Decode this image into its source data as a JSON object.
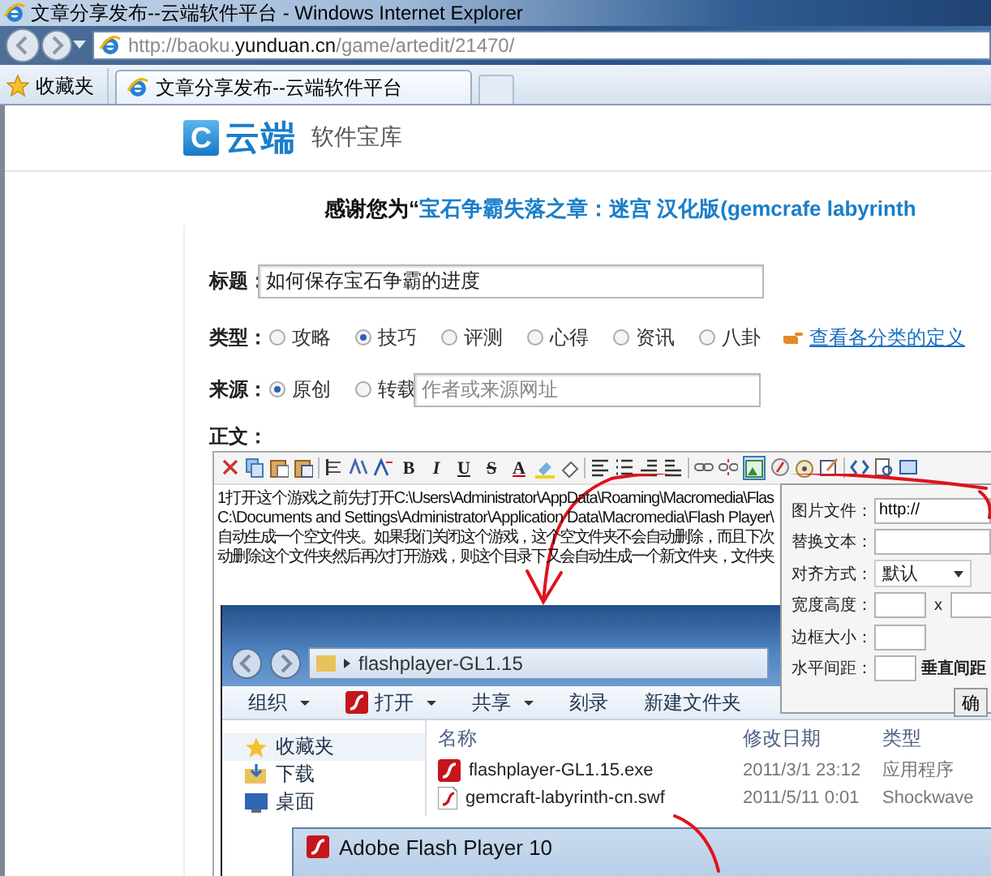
{
  "window": {
    "title": "文章分享发布--云端软件平台 - Windows Internet Explorer"
  },
  "address_bar": {
    "url": "http://baoku.**yunduan.cn**/game/artedit/21470/"
  },
  "favorites": {
    "label": "收藏夹"
  },
  "tabs": [
    {
      "label": "文章分享发布--云端软件平台",
      "selected": true
    }
  ],
  "site": {
    "logo_mark": "C",
    "logo_name": "云端",
    "logo_subtitle": "软件宝库"
  },
  "heading": {
    "prefix": "感谢您为“",
    "game_name": "宝石争霸失落之章：迷宫 汉化版(gemcrafe labyrinth"
  },
  "form": {
    "title_label": "标题：",
    "title_value": "如何保存宝石争霸的进度",
    "type_label": "类型：",
    "types": [
      {
        "label": "攻略",
        "selected": false
      },
      {
        "label": "技巧",
        "selected": true
      },
      {
        "label": "评测",
        "selected": false
      },
      {
        "label": "心得",
        "selected": false
      },
      {
        "label": "资讯",
        "selected": false
      },
      {
        "label": "八卦",
        "selected": false
      }
    ],
    "type_help_link": "查看各分类的定义",
    "source_label": "来源：",
    "sources": [
      {
        "label": "原创",
        "selected": true
      },
      {
        "label": "转载",
        "selected": false
      }
    ],
    "source_placeholder": "作者或来源网址",
    "body_label": "正文："
  },
  "editor": {
    "format_buttons": [
      "B",
      "I",
      "U",
      "S",
      "A"
    ],
    "image_tool_active": true,
    "lines": [
      "1打开这个游戏之前先打开C:\\Users\\Administrator\\AppData\\Roaming\\Macromedia\\Flas",
      "C:\\Documents and Settings\\Administrator\\Application Data\\Macromedia\\Flash Player\\",
      "自动生成一个空文件夹。如果我们关闭这个游戏，这个空文件夹不会自动删除，而且下次",
      "动删除这个文件夹然后再次打开游戏，则这个目录下又会自动生成一个新文件夹，文件夹"
    ]
  },
  "explorer": {
    "path": "flashplayer-GL1.15",
    "toolbar": [
      {
        "label": "组织",
        "kind": "menu"
      },
      {
        "label": "打开",
        "kind": "flash-menu"
      },
      {
        "label": "共享",
        "kind": "menu"
      },
      {
        "label": "刻录",
        "kind": "plain"
      },
      {
        "label": "新建文件夹",
        "kind": "plain"
      }
    ],
    "nav": [
      {
        "label": "收藏夹",
        "kind": "star",
        "selected": true
      },
      {
        "label": "下载",
        "kind": "download",
        "selected": false
      },
      {
        "label": "桌面",
        "kind": "desktop",
        "selected": false
      }
    ],
    "columns": [
      "名称",
      "修改日期",
      "类型"
    ],
    "files": [
      {
        "name": "flashplayer-GL1.15.exe",
        "modified": "2011/3/1 23:12",
        "type": "应用程序",
        "kind": "exe"
      },
      {
        "name": "gemcraft-labyrinth-cn.swf",
        "modified": "2011/5/11 0:01",
        "type": "Shockwave",
        "kind": "swf"
      }
    ],
    "flash_window": {
      "title": "Adobe Flash Player 10"
    }
  },
  "image_dialog": {
    "fields": [
      {
        "label": "图片文件：",
        "kind": "text",
        "value": "http://"
      },
      {
        "label": "替换文本：",
        "kind": "text"
      },
      {
        "label": "对齐方式：",
        "kind": "select",
        "value": "默认"
      },
      {
        "label": "宽度高度：",
        "kind": "pair",
        "separator": "x"
      },
      {
        "label": "边框大小：",
        "kind": "small"
      },
      {
        "label": "水平间距：",
        "kind": "spacing",
        "second_label": "垂直间距"
      }
    ],
    "button": "确"
  }
}
